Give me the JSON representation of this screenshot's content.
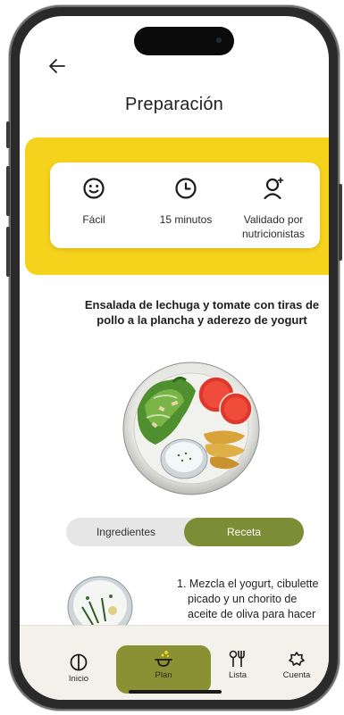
{
  "header": {
    "title": "Preparación",
    "back_icon": "arrow-left-icon"
  },
  "info": {
    "difficulty": {
      "label": "Fácil",
      "icon": "smiley-icon"
    },
    "time": {
      "label": "15 minutos",
      "icon": "clock-icon"
    },
    "validation": {
      "label_line1": "Validado por",
      "label_line2": "nutricionistas",
      "icon": "nutritionist-icon"
    }
  },
  "dish": {
    "title": "Ensalada de lechuga y tomate con tiras de pollo a la plancha y aderezo de yogurt"
  },
  "tabs": {
    "ingredients": "Ingredientes",
    "recipe": "Receta",
    "active": "recipe"
  },
  "steps": [
    {
      "number": "1.",
      "line1": "Mezcla el yogurt, cibulette",
      "line2": "picado y un chorito de",
      "line3": "aceite de oliva para hacer"
    }
  ],
  "nav": {
    "items": [
      {
        "label": "Inicio",
        "icon": "home-icon"
      },
      {
        "label": "Plan",
        "icon": "pot-icon"
      },
      {
        "label": "Lista",
        "icon": "utensils-icon"
      },
      {
        "label": "Cuenta",
        "icon": "sun-gear-icon"
      }
    ],
    "active_index": 1
  },
  "colors": {
    "yellow": "#f5d21c",
    "olive": "#7c8d35",
    "nav_active": "#8a9135"
  }
}
